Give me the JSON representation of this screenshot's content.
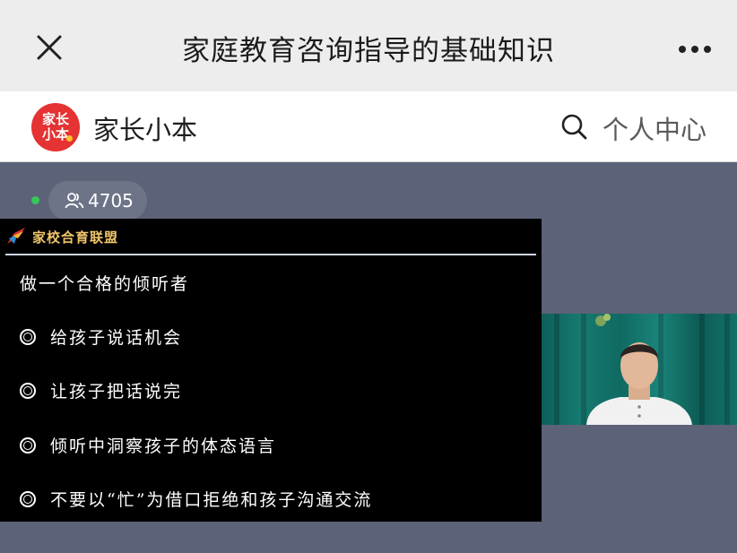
{
  "window": {
    "title": "家庭教育咨询指导的基础知识"
  },
  "header": {
    "logo_line1": "家长",
    "logo_line2": "小本",
    "brand_name": "家长小本",
    "profile_label": "个人中心"
  },
  "live": {
    "viewer_count": "4705"
  },
  "slide": {
    "brand": "家校合育联盟",
    "heading": "做一个合格的倾听者",
    "bullets": [
      "给孩子说话机会",
      "让孩子把话说完",
      "倾听中洞察孩子的体态语言",
      "不要以“忙”为借口拒绝和孩子沟通交流"
    ]
  },
  "colors": {
    "background": "#5c6278",
    "logo_red": "#e53232",
    "live_green": "#36c85a",
    "slide_brand_gold": "#f0c46a"
  }
}
